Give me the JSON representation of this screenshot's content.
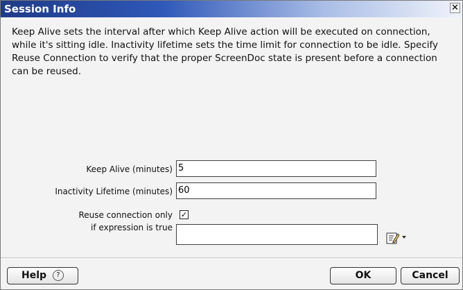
{
  "window": {
    "title": "Session Info",
    "close_glyph": "✕"
  },
  "description": "Keep Alive sets the interval after which Keep Alive action will be executed on connection, while it's sitting idle. Inactivity lifetime sets the time limit for connection to be idle. Specify Reuse Connection to verify that the proper ScreenDoc state is present before a connection can be reused.",
  "form": {
    "keep_alive": {
      "label": "Keep Alive (minutes)",
      "value": "5"
    },
    "inactivity": {
      "label": "Inactivity Lifetime (minutes)",
      "value": "60"
    },
    "reuse": {
      "label_line1": "Reuse connection only",
      "label_line2": "if expression is true",
      "checked": true,
      "checkmark": "✓",
      "expression_value": ""
    }
  },
  "icons": {
    "expression_editor": "edit-expression-icon",
    "dropdown": "dropdown-arrow-icon",
    "help": "help-icon"
  },
  "buttons": {
    "help": "Help",
    "help_glyph": "?",
    "ok": "OK",
    "cancel": "Cancel"
  },
  "colors": {
    "title_bar_start": "#1f3b88",
    "title_text": "#ffffff"
  }
}
